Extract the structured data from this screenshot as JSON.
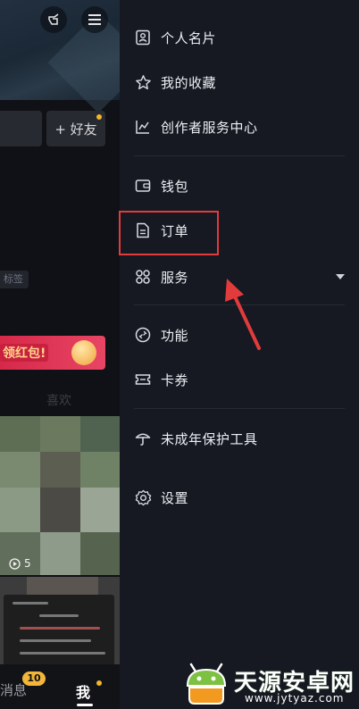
{
  "left_page": {
    "add_friend_label": "+ 好友",
    "tag_chip": "标签",
    "promo_text": "领红包!",
    "section_tab": "喜欢",
    "video_play_count": "5",
    "bottom_tabs": {
      "messages": "消息",
      "messages_badge": "10",
      "me": "我"
    }
  },
  "drawer": {
    "items": [
      {
        "label": "个人名片",
        "icon": "id-card-icon"
      },
      {
        "label": "我的收藏",
        "icon": "star-icon"
      },
      {
        "label": "创作者服务中心",
        "icon": "chart-icon"
      },
      {
        "label": "钱包",
        "icon": "wallet-icon"
      },
      {
        "label": "订单",
        "icon": "document-icon"
      },
      {
        "label": "服务",
        "icon": "grid-icon",
        "expandable": true
      },
      {
        "label": "功能",
        "icon": "link-icon"
      },
      {
        "label": "卡券",
        "icon": "ticket-icon"
      },
      {
        "label": "未成年保护工具",
        "icon": "umbrella-icon"
      },
      {
        "label": "设置",
        "icon": "gear-icon"
      }
    ]
  },
  "annotation": {
    "highlight_color": "#e23b3b",
    "highlighted_item": "订单"
  },
  "watermark": {
    "text": "天源安卓网",
    "url": "www.jytyaz.com"
  }
}
